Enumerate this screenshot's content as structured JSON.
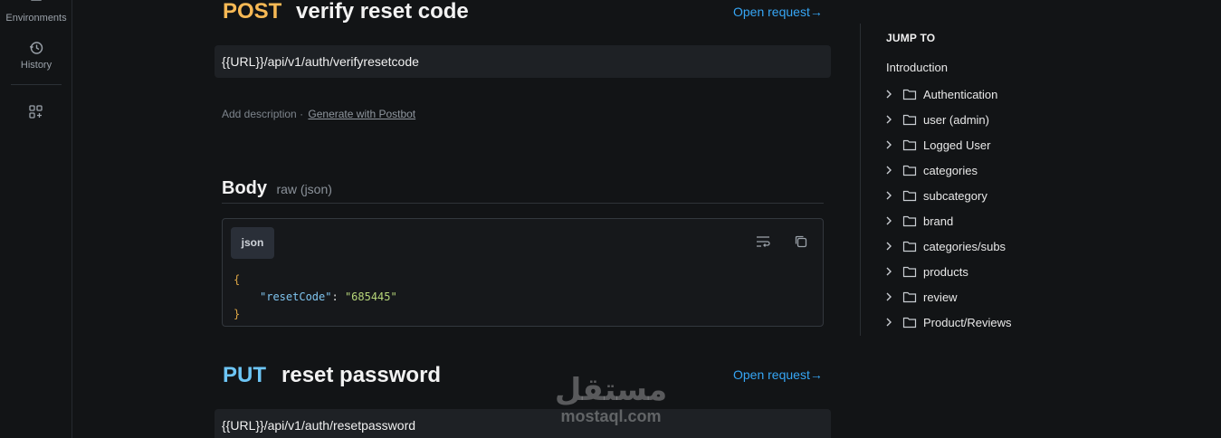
{
  "rail": {
    "environments_label": "Environments",
    "history_label": "History"
  },
  "requests": [
    {
      "method": "POST",
      "title": "verify reset code",
      "open_label": "Open request→",
      "url": "{{URL}}/api/v1/auth/verifyresetcode",
      "description_placeholder": "Add description",
      "description_sep": "·",
      "generate_label": "Generate with Postbot",
      "body_label": "Body",
      "body_type": "raw (json)",
      "lang": "json",
      "code": {
        "open_brace": "{",
        "key": "\"resetCode\"",
        "colon": ": ",
        "value": "\"685445\"",
        "close_brace": "}"
      }
    },
    {
      "method": "PUT",
      "title": "reset password",
      "open_label": "Open request→",
      "url": "{{URL}}/api/v1/auth/resetpassword"
    }
  ],
  "toc": {
    "title": "JUMP TO",
    "intro": "Introduction",
    "items": [
      "Authentication",
      "user (admin)",
      "Logged User",
      "categories",
      "subcategory",
      "brand",
      "categories/subs",
      "products",
      "review",
      "Product/Reviews"
    ]
  },
  "watermark": {
    "arabic": "مستقل",
    "latin": "mostaql.com"
  },
  "colors": {
    "post": "#f7b955",
    "put": "#6dc5f5",
    "link": "#36a6f5"
  }
}
